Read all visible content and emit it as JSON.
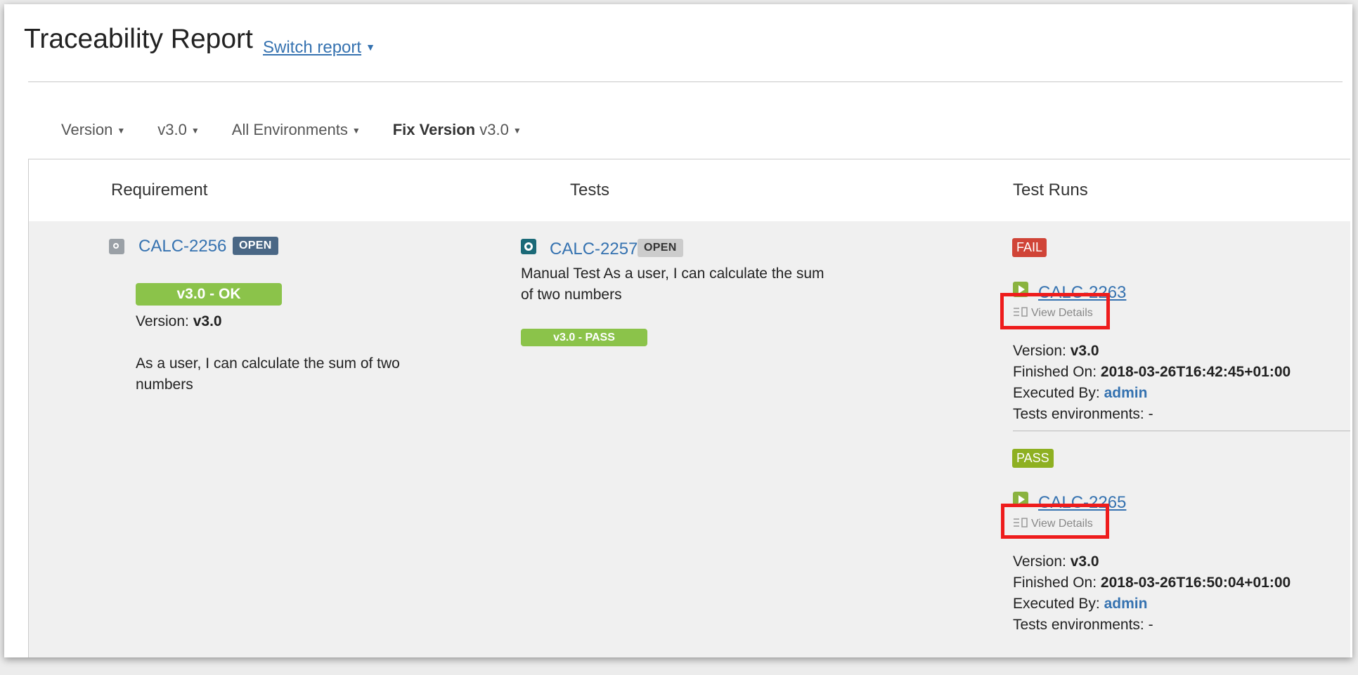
{
  "header": {
    "title": "Traceability Report",
    "switch_label": "Switch report"
  },
  "filters": [
    {
      "label": "Version"
    },
    {
      "label": "v3.0"
    },
    {
      "label": "All Environments"
    },
    {
      "label_bold": "Fix Version",
      "label": "v3.0"
    }
  ],
  "table": {
    "columns": [
      "Requirement",
      "Tests",
      "Test Runs"
    ]
  },
  "requirement": {
    "key": "CALC-2256",
    "status": "OPEN",
    "coverage": "v3.0 - OK",
    "version_label": "Version:",
    "version_value": "v3.0",
    "summary_line1": "As a user, I can calculate the sum of two",
    "summary_line2": "numbers"
  },
  "test": {
    "key": "CALC-2257",
    "status": "OPEN",
    "desc_line1": "Manual Test As a user, I can calculate the sum",
    "desc_line2": "of two numbers",
    "result": "v3.0 - PASS"
  },
  "runs": [
    {
      "status": "FAIL",
      "key": "CALC-2263",
      "view_details": "View Details",
      "version_label": "Version:",
      "version_value": "v3.0",
      "finished_label": "Finished On:",
      "finished_value": "2018-03-26T16:42:45+01:00",
      "executed_label": "Executed By:",
      "executed_value": "admin",
      "env_label": "Tests environments: -"
    },
    {
      "status": "PASS",
      "key": "CALC-2265",
      "view_details": "View Details",
      "version_label": "Version:",
      "version_value": "v3.0",
      "finished_label": "Finished On:",
      "finished_value": "2018-03-26T16:50:04+01:00",
      "executed_label": "Executed By:",
      "executed_value": "admin",
      "env_label": "Tests environments: -"
    }
  ],
  "colors": {
    "link": "#3572b0",
    "fail": "#d04437",
    "pass": "#8eb021",
    "ok_green": "#8bc34a",
    "highlight": "#ee1c1c"
  }
}
